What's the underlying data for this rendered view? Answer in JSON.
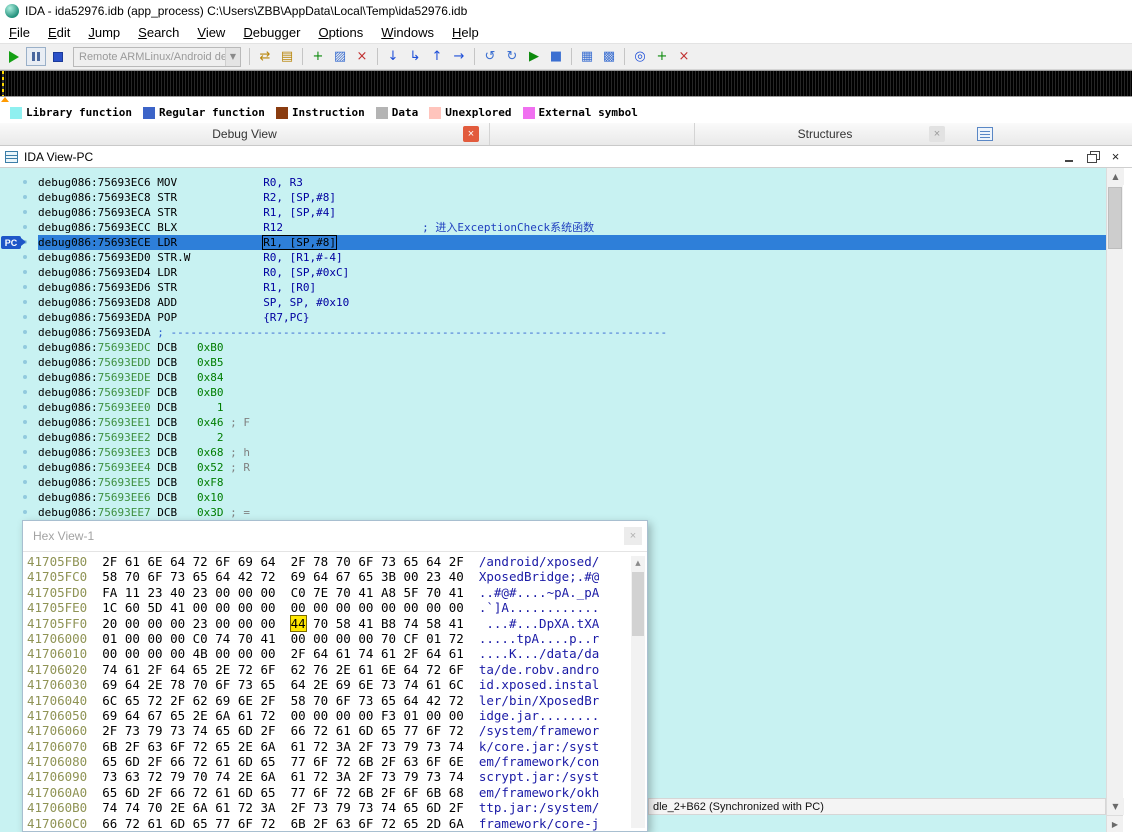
{
  "titlebar": {
    "title": "IDA - ida52976.idb (app_process) C:\\Users\\ZBB\\AppData\\Local\\Temp\\ida52976.idb"
  },
  "menu": {
    "items": [
      "File",
      "Edit",
      "Jump",
      "Search",
      "View",
      "Debugger",
      "Options",
      "Windows",
      "Help"
    ]
  },
  "toolbar": {
    "debugger_combo": "Remote ARMLinux/Android debugger",
    "icon_groups": [
      [
        {
          "name": "attach-process-icon",
          "glyph": "⇄",
          "color": "#b8860b"
        },
        {
          "name": "process-options-icon",
          "glyph": "▤",
          "color": "#b8860b"
        }
      ],
      [
        {
          "name": "add-breakpoint-icon",
          "glyph": "+",
          "color": "#0c8a0c"
        },
        {
          "name": "edit-breakpoint-icon",
          "glyph": "▨",
          "color": "#3b6fd1"
        },
        {
          "name": "delete-breakpoint-icon",
          "glyph": "×",
          "color": "#c03030"
        }
      ],
      [
        {
          "name": "step-into-icon",
          "glyph": "↓",
          "color": "#1d4ed8"
        },
        {
          "name": "step-over-icon",
          "glyph": "↳",
          "color": "#1d4ed8"
        },
        {
          "name": "run-until-return-icon",
          "glyph": "↑",
          "color": "#1d4ed8"
        },
        {
          "name": "run-to-cursor-icon",
          "glyph": "→",
          "color": "#1d4ed8"
        }
      ],
      [
        {
          "name": "nav-back-icon",
          "glyph": "↺",
          "color": "#3b6fd1"
        },
        {
          "name": "nav-forward-icon",
          "glyph": "↻",
          "color": "#3b6fd1"
        },
        {
          "name": "run-trace-icon",
          "glyph": "▶",
          "color": "#0c8a0c"
        },
        {
          "name": "stop-trace-icon",
          "glyph": "■",
          "color": "#3b6fd1"
        }
      ],
      [
        {
          "name": "tile-windows-icon",
          "glyph": "▦",
          "color": "#3b6fd1"
        },
        {
          "name": "cascade-windows-icon",
          "glyph": "▩",
          "color": "#3b6fd1"
        }
      ],
      [
        {
          "name": "search-memory-icon",
          "glyph": "◎",
          "color": "#1d4ed8"
        },
        {
          "name": "add-bookmark-icon",
          "glyph": "+",
          "color": "#0c8a0c"
        },
        {
          "name": "delete-bookmark-icon",
          "glyph": "×",
          "color": "#c03030"
        }
      ]
    ]
  },
  "legend": {
    "items": [
      {
        "label": "Library function",
        "color": "#8ff0f0"
      },
      {
        "label": "Regular function",
        "color": "#3c64c8"
      },
      {
        "label": "Instruction",
        "color": "#8a3c10"
      },
      {
        "label": "Data",
        "color": "#b4b4b4"
      },
      {
        "label": "Unexplored",
        "color": "#ffc4bc"
      },
      {
        "label": "External symbol",
        "color": "#f070f0"
      }
    ]
  },
  "tabs": {
    "debug_view": "Debug View",
    "structures": "Structures"
  },
  "ida_view": {
    "title": "IDA View-PC",
    "lines": [
      {
        "seg": "debug086",
        "off": "75693EC6",
        "kind": "code",
        "mnem": "MOV",
        "ops": "R0, R3"
      },
      {
        "seg": "debug086",
        "off": "75693EC8",
        "kind": "code",
        "mnem": "STR",
        "ops": "R2, [SP,#8]"
      },
      {
        "seg": "debug086",
        "off": "75693ECA",
        "kind": "code",
        "mnem": "STR",
        "ops": "R1, [SP,#4]"
      },
      {
        "seg": "debug086",
        "off": "75693ECC",
        "kind": "code",
        "mnem": "BLX",
        "ops": "R12",
        "comment": "进入ExceptionCheck系统函数"
      },
      {
        "seg": "debug086",
        "off": "75693ECE",
        "kind": "code",
        "mnem": "LDR",
        "ops": "R1, [SP,#8]",
        "pc": true
      },
      {
        "seg": "debug086",
        "off": "75693ED0",
        "kind": "code",
        "mnem": "STR.W",
        "ops": "R0, [R1,#-4]"
      },
      {
        "seg": "debug086",
        "off": "75693ED4",
        "kind": "code",
        "mnem": "LDR",
        "ops": "R0, [SP,#0xC]"
      },
      {
        "seg": "debug086",
        "off": "75693ED6",
        "kind": "code",
        "mnem": "STR",
        "ops": "R1, [R0]"
      },
      {
        "seg": "debug086",
        "off": "75693ED8",
        "kind": "code",
        "mnem": "ADD",
        "ops": "SP, SP, #0x10"
      },
      {
        "seg": "debug086",
        "off": "75693EDA",
        "kind": "code",
        "mnem": "POP",
        "ops": "{R7,PC}"
      },
      {
        "seg": "debug086",
        "off": "75693EDA",
        "kind": "sep",
        "text": "; ---------------------------------------------------------------------------"
      },
      {
        "seg": "debug086",
        "off": "75693EDC",
        "kind": "data",
        "mnem": "DCB",
        "ops": "0xB0"
      },
      {
        "seg": "debug086",
        "off": "75693EDD",
        "kind": "data",
        "mnem": "DCB",
        "ops": "0xB5"
      },
      {
        "seg": "debug086",
        "off": "75693EDE",
        "kind": "data",
        "mnem": "DCB",
        "ops": "0x84"
      },
      {
        "seg": "debug086",
        "off": "75693EDF",
        "kind": "data",
        "mnem": "DCB",
        "ops": "0xB0"
      },
      {
        "seg": "debug086",
        "off": "75693EE0",
        "kind": "data",
        "mnem": "DCB",
        "ops": "   1"
      },
      {
        "seg": "debug086",
        "off": "75693EE1",
        "kind": "data",
        "mnem": "DCB",
        "ops": "0x46",
        "comment": "F"
      },
      {
        "seg": "debug086",
        "off": "75693EE2",
        "kind": "data",
        "mnem": "DCB",
        "ops": "   2"
      },
      {
        "seg": "debug086",
        "off": "75693EE3",
        "kind": "data",
        "mnem": "DCB",
        "ops": "0x68",
        "comment": "h"
      },
      {
        "seg": "debug086",
        "off": "75693EE4",
        "kind": "data",
        "mnem": "DCB",
        "ops": "0x52",
        "comment": "R"
      },
      {
        "seg": "debug086",
        "off": "75693EE5",
        "kind": "data",
        "mnem": "DCB",
        "ops": "0xF8"
      },
      {
        "seg": "debug086",
        "off": "75693EE6",
        "kind": "data",
        "mnem": "DCB",
        "ops": "0x10"
      },
      {
        "seg": "debug086",
        "off": "75693EE7",
        "kind": "data",
        "mnem": "DCB",
        "ops": "0x3D",
        "comment": "="
      }
    ]
  },
  "hex_view": {
    "title": "Hex View-1",
    "highlight": {
      "row": 4,
      "byte": 8
    },
    "rows": [
      {
        "addr": "41705FB0",
        "bytes": [
          "2F",
          "61",
          "6E",
          "64",
          "72",
          "6F",
          "69",
          "64",
          "2F",
          "78",
          "70",
          "6F",
          "73",
          "65",
          "64",
          "2F"
        ],
        "ascii": "/android/xposed/"
      },
      {
        "addr": "41705FC0",
        "bytes": [
          "58",
          "70",
          "6F",
          "73",
          "65",
          "64",
          "42",
          "72",
          "69",
          "64",
          "67",
          "65",
          "3B",
          "00",
          "23",
          "40"
        ],
        "ascii": "XposedBridge;.#@"
      },
      {
        "addr": "41705FD0",
        "bytes": [
          "FA",
          "11",
          "23",
          "40",
          "23",
          "00",
          "00",
          "00",
          "C0",
          "7E",
          "70",
          "41",
          "A8",
          "5F",
          "70",
          "41"
        ],
        "ascii": "..#@#....~pA._pA"
      },
      {
        "addr": "41705FE0",
        "bytes": [
          "1C",
          "60",
          "5D",
          "41",
          "00",
          "00",
          "00",
          "00",
          "00",
          "00",
          "00",
          "00",
          "00",
          "00",
          "00",
          "00"
        ],
        "ascii": ".`]A............"
      },
      {
        "addr": "41705FF0",
        "bytes": [
          "20",
          "00",
          "00",
          "00",
          "23",
          "00",
          "00",
          "00",
          "44",
          "70",
          "58",
          "41",
          "B8",
          "74",
          "58",
          "41"
        ],
        "ascii": " ...#...DpXA.tXA"
      },
      {
        "addr": "41706000",
        "bytes": [
          "01",
          "00",
          "00",
          "00",
          "C0",
          "74",
          "70",
          "41",
          "00",
          "00",
          "00",
          "00",
          "70",
          "CF",
          "01",
          "72"
        ],
        "ascii": ".....tpA....p..r"
      },
      {
        "addr": "41706010",
        "bytes": [
          "00",
          "00",
          "00",
          "00",
          "4B",
          "00",
          "00",
          "00",
          "2F",
          "64",
          "61",
          "74",
          "61",
          "2F",
          "64",
          "61"
        ],
        "ascii": "....K.../data/da"
      },
      {
        "addr": "41706020",
        "bytes": [
          "74",
          "61",
          "2F",
          "64",
          "65",
          "2E",
          "72",
          "6F",
          "62",
          "76",
          "2E",
          "61",
          "6E",
          "64",
          "72",
          "6F"
        ],
        "ascii": "ta/de.robv.andro"
      },
      {
        "addr": "41706030",
        "bytes": [
          "69",
          "64",
          "2E",
          "78",
          "70",
          "6F",
          "73",
          "65",
          "64",
          "2E",
          "69",
          "6E",
          "73",
          "74",
          "61",
          "6C"
        ],
        "ascii": "id.xposed.instal"
      },
      {
        "addr": "41706040",
        "bytes": [
          "6C",
          "65",
          "72",
          "2F",
          "62",
          "69",
          "6E",
          "2F",
          "58",
          "70",
          "6F",
          "73",
          "65",
          "64",
          "42",
          "72"
        ],
        "ascii": "ler/bin/XposedBr"
      },
      {
        "addr": "41706050",
        "bytes": [
          "69",
          "64",
          "67",
          "65",
          "2E",
          "6A",
          "61",
          "72",
          "00",
          "00",
          "00",
          "00",
          "F3",
          "01",
          "00",
          "00"
        ],
        "ascii": "idge.jar........"
      },
      {
        "addr": "41706060",
        "bytes": [
          "2F",
          "73",
          "79",
          "73",
          "74",
          "65",
          "6D",
          "2F",
          "66",
          "72",
          "61",
          "6D",
          "65",
          "77",
          "6F",
          "72"
        ],
        "ascii": "/system/framewor"
      },
      {
        "addr": "41706070",
        "bytes": [
          "6B",
          "2F",
          "63",
          "6F",
          "72",
          "65",
          "2E",
          "6A",
          "61",
          "72",
          "3A",
          "2F",
          "73",
          "79",
          "73",
          "74"
        ],
        "ascii": "k/core.jar:/syst"
      },
      {
        "addr": "41706080",
        "bytes": [
          "65",
          "6D",
          "2F",
          "66",
          "72",
          "61",
          "6D",
          "65",
          "77",
          "6F",
          "72",
          "6B",
          "2F",
          "63",
          "6F",
          "6E"
        ],
        "ascii": "em/framework/con"
      },
      {
        "addr": "41706090",
        "bytes": [
          "73",
          "63",
          "72",
          "79",
          "70",
          "74",
          "2E",
          "6A",
          "61",
          "72",
          "3A",
          "2F",
          "73",
          "79",
          "73",
          "74"
        ],
        "ascii": "scrypt.jar:/syst"
      },
      {
        "addr": "417060A0",
        "bytes": [
          "65",
          "6D",
          "2F",
          "66",
          "72",
          "61",
          "6D",
          "65",
          "77",
          "6F",
          "72",
          "6B",
          "2F",
          "6F",
          "6B",
          "68"
        ],
        "ascii": "em/framework/okh"
      },
      {
        "addr": "417060B0",
        "bytes": [
          "74",
          "74",
          "70",
          "2E",
          "6A",
          "61",
          "72",
          "3A",
          "2F",
          "73",
          "79",
          "73",
          "74",
          "65",
          "6D",
          "2F"
        ],
        "ascii": "ttp.jar:/system/"
      },
      {
        "addr": "417060C0",
        "bytes": [
          "66",
          "72",
          "61",
          "6D",
          "65",
          "77",
          "6F",
          "72",
          "6B",
          "2F",
          "63",
          "6F",
          "72",
          "65",
          "2D",
          "6A"
        ],
        "ascii": "framework/core-j"
      }
    ]
  },
  "status": {
    "text": "dle_2+B62 (Synchronized with PC)"
  }
}
